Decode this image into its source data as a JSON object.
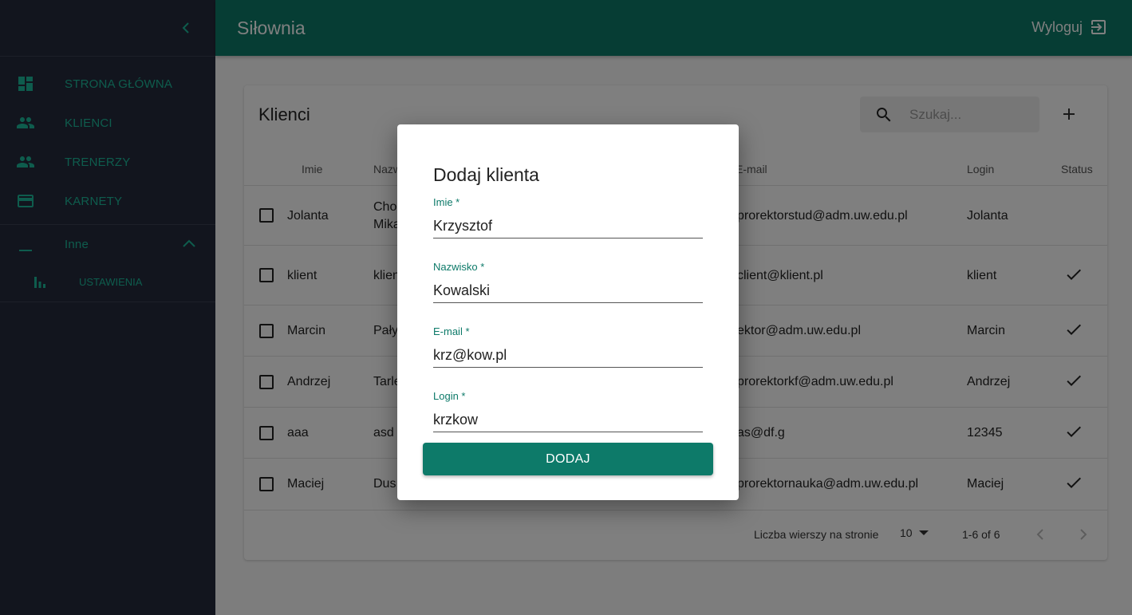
{
  "sidebar": {
    "items": [
      {
        "label": "STRONA GŁÓWNA",
        "icon": "dashboard-icon"
      },
      {
        "label": "KLIENCI",
        "icon": "people-icon"
      },
      {
        "label": "TRENERZY",
        "icon": "people-icon"
      },
      {
        "label": "KARNETY",
        "icon": "credit-card-icon"
      }
    ],
    "group": {
      "label": "Inne",
      "expanded": true
    },
    "subitems": [
      {
        "label": "USTAWIENIA",
        "icon": "bar-chart-icon"
      }
    ]
  },
  "appbar": {
    "title": "Siłownia",
    "logout_label": "Wyloguj"
  },
  "table": {
    "title": "Klienci",
    "search_placeholder": "Szukaj...",
    "columns": {
      "imie": "Imie",
      "nazwisko": "Nazw",
      "email": "E-mail",
      "login": "Login",
      "status": "Status"
    },
    "rows": [
      {
        "imie": "Jolanta",
        "nazwisko_l1": "Cho",
        "nazwisko_l2": "Mika",
        "email": "prorektorstud@adm.uw.edu.pl",
        "login": "Jolanta",
        "status": false
      },
      {
        "imie": "klient",
        "nazwisko_l1": "klien",
        "nazwisko_l2": "",
        "email": "client@klient.pl",
        "login": "klient",
        "status": true
      },
      {
        "imie": "Marcin",
        "nazwisko_l1": "Pały",
        "nazwisko_l2": "",
        "email": "ektor@adm.uw.edu.pl",
        "login": "Marcin",
        "status": true
      },
      {
        "imie": "Andrzej",
        "nazwisko_l1": "Tarle",
        "nazwisko_l2": "",
        "email": "prorektorkf@adm.uw.edu.pl",
        "login": "Andrzej",
        "status": true
      },
      {
        "imie": "aaa",
        "nazwisko_l1": "asd",
        "nazwisko_l2": "",
        "email": "as@df.g",
        "login": "12345",
        "status": true
      },
      {
        "imie": "Maciej",
        "nazwisko_l1": "Dus",
        "nazwisko_l2": "",
        "email": "prorektornauka@adm.uw.edu.pl",
        "login": "Maciej",
        "status": true
      }
    ],
    "footer": {
      "rows_per_page_label": "Liczba wierszy na stronie",
      "rows_per_page_value": "10",
      "range": "1-6 of 6"
    }
  },
  "dialog": {
    "title": "Dodaj klienta",
    "fields": [
      {
        "label": "Imie *",
        "value": "Krzysztof"
      },
      {
        "label": "Nazwisko *",
        "value": "Kowalski"
      },
      {
        "label": "E-mail *",
        "value": "krz@kow.pl"
      },
      {
        "label": "Login *",
        "value": "krzkow"
      }
    ],
    "submit_label": "DODAJ"
  },
  "colors": {
    "primary": "#0d7a69",
    "sidebar": "#252b3d",
    "nav_text": "#1db99a"
  }
}
